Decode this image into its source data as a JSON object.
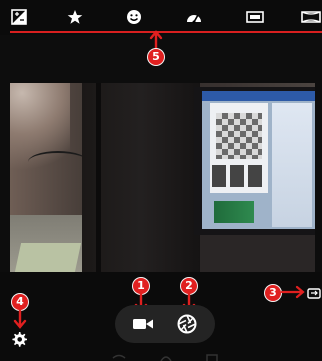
{
  "toolbar": {
    "items": [
      {
        "icon": "exposure-icon"
      },
      {
        "icon": "star-icon"
      },
      {
        "icon": "face-icon"
      },
      {
        "icon": "speedometer-icon"
      },
      {
        "icon": "panorama-icon"
      },
      {
        "icon": "wide-icon"
      }
    ],
    "accent": "#d81f1f"
  },
  "annotations": {
    "badge_1": "1",
    "badge_2": "2",
    "badge_3": "3",
    "badge_4": "4",
    "badge_5": "5",
    "badge_color": "#e02020"
  },
  "controls": {
    "video_icon": "video-camera-icon",
    "shutter_icon": "aperture-icon",
    "settings_icon": "gear-icon",
    "switch_icon": "camera-switch-icon"
  },
  "nav": {
    "items": [
      "back-icon",
      "home-icon",
      "recents-icon"
    ]
  }
}
